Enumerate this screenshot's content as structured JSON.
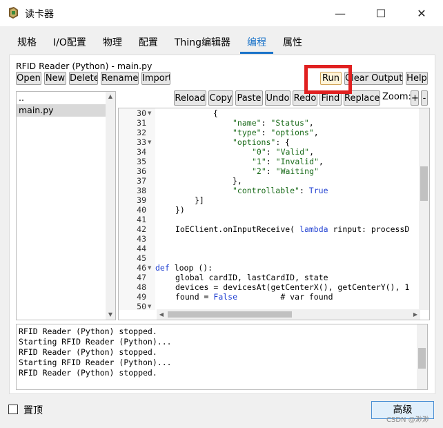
{
  "window": {
    "title": "读卡器",
    "minimize": "—",
    "maximize": "☐",
    "close": "✕"
  },
  "tabs": [
    {
      "label": "规格"
    },
    {
      "label": "I/O配置"
    },
    {
      "label": "物理"
    },
    {
      "label": "配置"
    },
    {
      "label": "Thing编辑器"
    },
    {
      "label": "编程",
      "active": true
    },
    {
      "label": "属性"
    }
  ],
  "file_title": "RFID Reader (Python) - main.py",
  "file_buttons": {
    "open": "Open",
    "new": "New",
    "delete": "Delete",
    "rename": "Rename",
    "import": "Import"
  },
  "right_buttons": {
    "run": "Run",
    "clear_outputs": "Clear Outputs",
    "help": "Help"
  },
  "editor_toolbar": {
    "reload": "Reload",
    "copy": "Copy",
    "paste": "Paste",
    "undo": "Undo",
    "redo": "Redo",
    "find": "Find",
    "replace": "Replace",
    "zoom_label": "Zoom:",
    "zoom_in": "+",
    "zoom_out": "-"
  },
  "files": [
    {
      "name": ".."
    },
    {
      "name": "main.py",
      "selected": true
    }
  ],
  "code_lines": [
    {
      "n": "30",
      "fold": true
    },
    {
      "n": "31"
    },
    {
      "n": "32"
    },
    {
      "n": "33",
      "fold": true
    },
    {
      "n": "34"
    },
    {
      "n": "35"
    },
    {
      "n": "36"
    },
    {
      "n": "37"
    },
    {
      "n": "38"
    },
    {
      "n": "39"
    },
    {
      "n": "40"
    },
    {
      "n": "41"
    },
    {
      "n": "42"
    },
    {
      "n": "43"
    },
    {
      "n": "44"
    },
    {
      "n": "45"
    },
    {
      "n": "46",
      "fold": true
    },
    {
      "n": "47"
    },
    {
      "n": "48"
    },
    {
      "n": "49"
    },
    {
      "n": "50",
      "fold": true
    }
  ],
  "code": {
    "l30": "{",
    "l31_key": "\"name\"",
    "l31_val": "\"Status\"",
    "l32_key": "\"type\"",
    "l32_val": "\"options\"",
    "l33_key": "\"options\"",
    "l33_rest": ": {",
    "l34_key": "\"0\"",
    "l34_val": "\"Valid\"",
    "l35_key": "\"1\"",
    "l35_val": "\"Invalid\"",
    "l36_key": "\"2\"",
    "l36_val": "\"Waiting\"",
    "l37": "},",
    "l38_key": "\"controllable\"",
    "l38_val": "True",
    "l39": "}]",
    "l40": "})",
    "l42_a": "IoEClient.onInputReceive( ",
    "l42_kw": "lambda",
    "l42_b": " rinput: processD",
    "l46_kw": "def",
    "l46_rest": " loop ():",
    "l47": "global cardID, lastCardID, state",
    "l48": "devices = devicesAt(getCenterX(), getCenterY(), 1",
    "l49_a": "found = ",
    "l49_kw": "False",
    "l49_b": "         # var found"
  },
  "output_lines": [
    "RFID Reader (Python) stopped.",
    "Starting RFID Reader (Python)...",
    "RFID Reader (Python) stopped.",
    "Starting RFID Reader (Python)...",
    "RFID Reader (Python) stopped."
  ],
  "bottom": {
    "checkbox_label": "置顶",
    "advanced_button": "高级",
    "watermark": "CSDN @渺渺"
  }
}
